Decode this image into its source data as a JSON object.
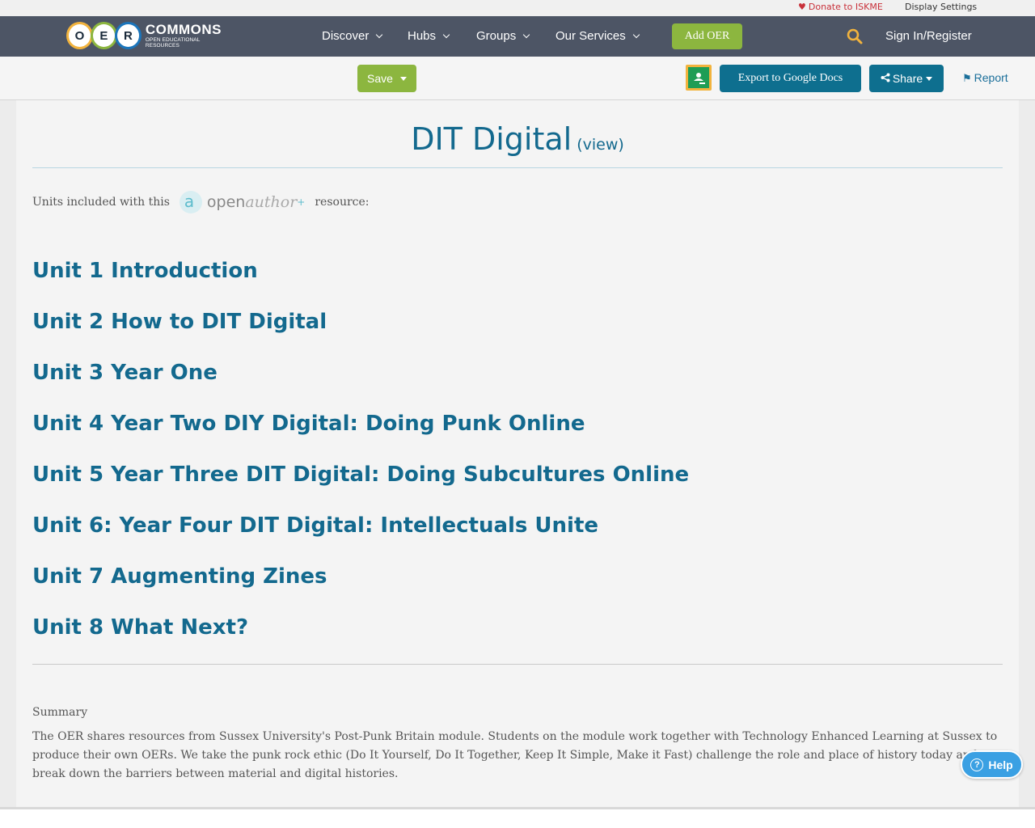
{
  "utility": {
    "donate": "Donate to ISKME",
    "display_settings": "Display Settings"
  },
  "logo": {
    "letters": [
      "O",
      "E",
      "R"
    ],
    "name": "COMMONS",
    "tagline": "OPEN EDUCATIONAL RESOURCES"
  },
  "nav": {
    "items": [
      {
        "label": "Discover"
      },
      {
        "label": "Hubs"
      },
      {
        "label": "Groups"
      },
      {
        "label": "Our Services"
      }
    ],
    "add_oer": "Add OER",
    "signin": "Sign In/Register"
  },
  "toolbar": {
    "save": "Save",
    "export_google_docs": "Export to Google Docs",
    "share": "Share",
    "report": "Report"
  },
  "main": {
    "title": "DIT Digital",
    "view_link": "(view)",
    "units_intro_before": "Units included with this",
    "units_intro_after": "resource:",
    "openauthor": {
      "open": "open",
      "author": "author",
      "plus": "+"
    },
    "units": [
      "Unit 1 Introduction",
      "Unit 2 How to DIT Digital",
      "Unit 3 Year One",
      "Unit 4 Year Two DIY Digital: Doing Punk Online",
      "Unit 5 Year Three DIT Digital: Doing Subcultures Online",
      "Unit 6: Year Four DIT Digital: Intellectuals Unite",
      "Unit 7 Augmenting Zines",
      "Unit 8 What Next?"
    ],
    "summary_label": "Summary",
    "summary_text": "The OER shares resources from Sussex University's Post-Punk Britain module. Students on the module work together with Technology Enhanced Learning at Sussex to produce their own OERs. We take the punk rock ethic (Do It Yourself, Do It Together, Keep It Simple, Make it Fast) challenge the role and place of history today and to break down the barriers between material and digital histories."
  },
  "help": {
    "label": "Help"
  },
  "colors": {
    "nav_bg": "#4d5565",
    "accent_green": "#8cb63f",
    "brand_teal": "#0e6f8f",
    "link_blue": "#13698e",
    "donate_red": "#c8313a",
    "search_yellow": "#f2b33d"
  }
}
